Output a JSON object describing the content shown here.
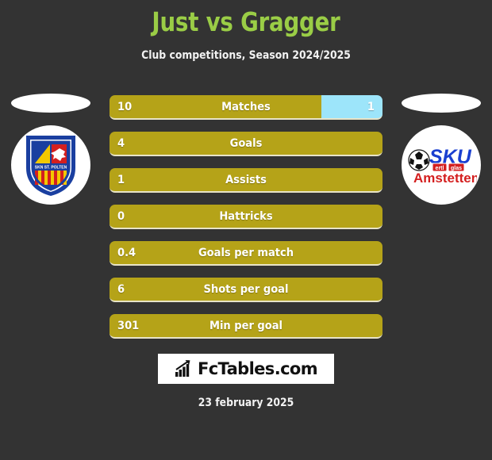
{
  "header": {
    "title": "Just vs Gragger",
    "subtitle": "Club competitions, Season 2024/2025",
    "title_color": "#9ACD46"
  },
  "theme": {
    "background": "#333333",
    "bar_color": "#B5A318",
    "bar_alt_color": "#9DE5FA",
    "text_color": "#FFFFFF"
  },
  "teams": {
    "left": {
      "name": "SKN ST. POLTEN",
      "crest_text": "SKN ST. POLTEN",
      "icon": "skn-st-polten-crest-icon"
    },
    "right": {
      "name": "SKU Amstetten",
      "mark_primary": "SKU",
      "mark_secondary": "Amstetten",
      "badge_one": "ertl",
      "badge_two": "glas",
      "icon": "sku-amstetten-logo-icon"
    }
  },
  "stats": [
    {
      "label": "Matches",
      "left_value": "10",
      "right_value": "1",
      "left_pct": 77.5
    },
    {
      "label": "Goals",
      "left_value": "4",
      "right_value": "",
      "left_pct": 100
    },
    {
      "label": "Assists",
      "left_value": "1",
      "right_value": "",
      "left_pct": 100
    },
    {
      "label": "Hattricks",
      "left_value": "0",
      "right_value": "",
      "left_pct": 100
    },
    {
      "label": "Goals per match",
      "left_value": "0.4",
      "right_value": "",
      "left_pct": 100
    },
    {
      "label": "Shots per goal",
      "left_value": "6",
      "right_value": "",
      "left_pct": 100
    },
    {
      "label": "Min per goal",
      "left_value": "301",
      "right_value": "",
      "left_pct": 100
    }
  ],
  "watermark": {
    "text": "FcTables.com",
    "icon": "bar-chart-arrow-icon"
  },
  "footer": {
    "date": "23 february 2025"
  },
  "chart_data": {
    "type": "bar",
    "title": "Just vs Gragger",
    "subtitle": "Club competitions, Season 2024/2025",
    "categories": [
      "Matches",
      "Goals",
      "Assists",
      "Hattricks",
      "Goals per match",
      "Shots per goal",
      "Min per goal"
    ],
    "series": [
      {
        "name": "Just",
        "values": [
          10,
          4,
          1,
          0,
          0.4,
          6,
          301
        ]
      },
      {
        "name": "Gragger",
        "values": [
          1,
          null,
          null,
          null,
          null,
          null,
          null
        ]
      }
    ],
    "xlabel": "",
    "ylabel": "",
    "grid": false,
    "legend": "none",
    "orientation": "horizontal"
  }
}
